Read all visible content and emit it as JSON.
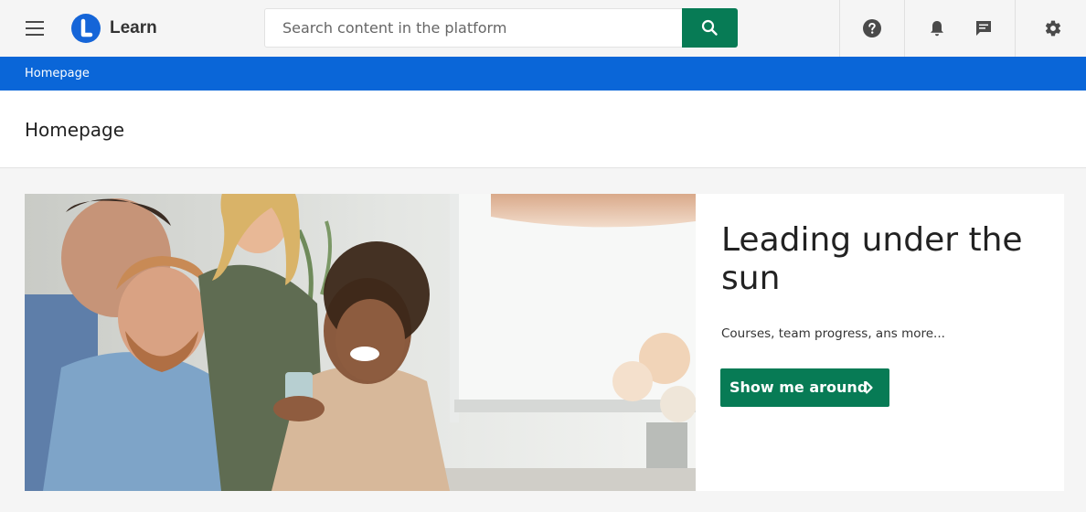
{
  "app": {
    "name": "Learn"
  },
  "search": {
    "placeholder": "Search content in the platform"
  },
  "header_icons": [
    "menu-icon",
    "search-icon",
    "help-icon",
    "bell-icon",
    "chat-icon",
    "gear-icon"
  ],
  "breadcrumb": {
    "items": [
      "Homepage"
    ]
  },
  "page": {
    "title": "Homepage"
  },
  "hero": {
    "title": "Leading under the sun",
    "subtitle": "Courses, team progress, ans more...",
    "button_label": "Show me around"
  },
  "colors": {
    "brand_blue": "#0a66d8",
    "accent_green": "#077b55"
  }
}
